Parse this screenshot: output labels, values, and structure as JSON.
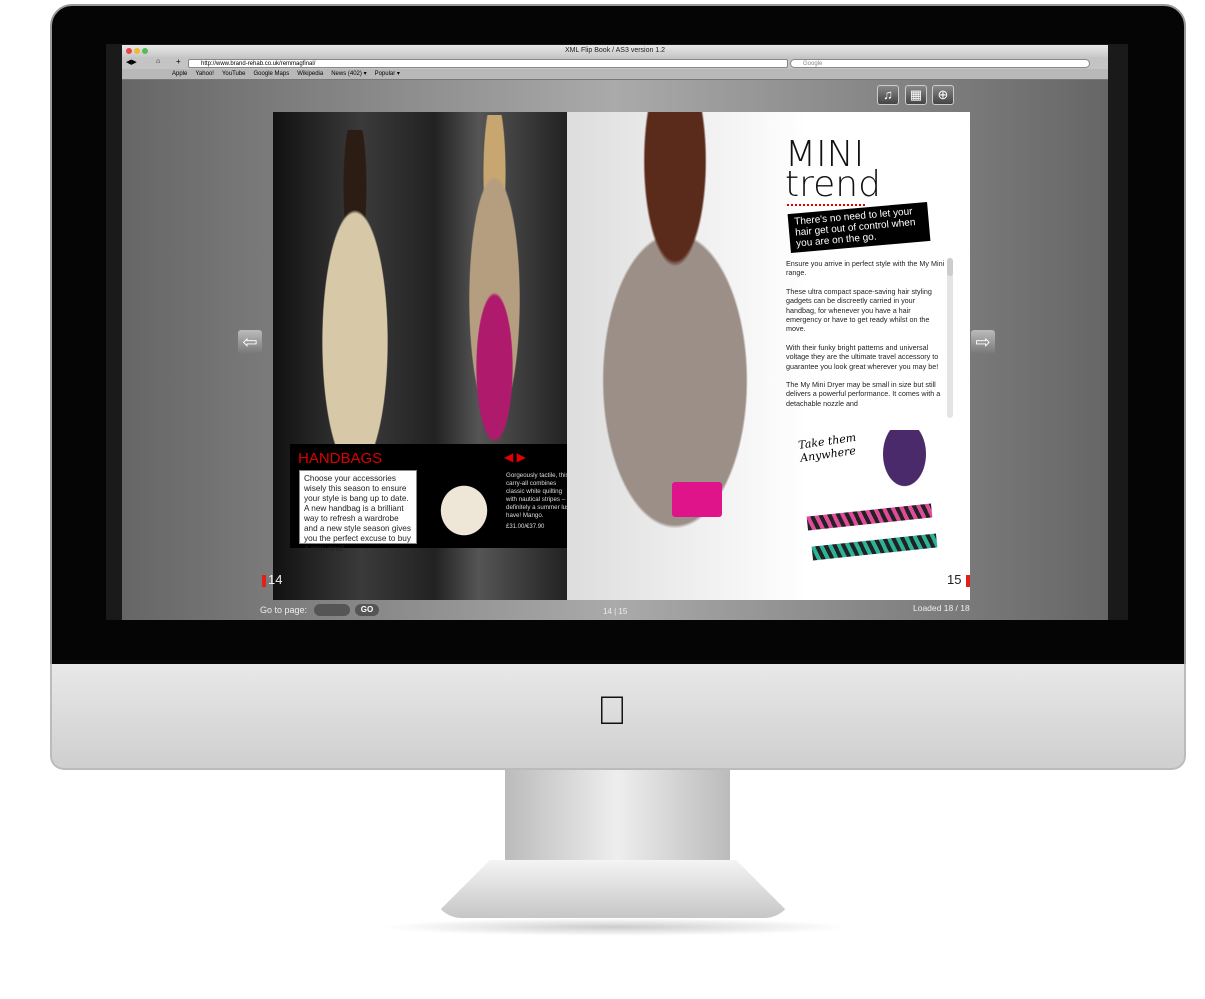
{
  "browser": {
    "title": "XML Flip Book / AS3 version 1.2",
    "url": "http://www.brand-rehab.co.uk/remmagfinal/",
    "search_placeholder": "Google",
    "bookmarks": [
      "Apple",
      "Yahoo!",
      "YouTube",
      "Google Maps",
      "Wikipedia",
      "News (402) ▾",
      "Popular ▾"
    ]
  },
  "toolbar": {
    "music": "♫",
    "film": "▦",
    "zoom": "⊕"
  },
  "nav": {
    "prev": "⇦",
    "next": "⇨"
  },
  "left_page": {
    "number": "14",
    "handbags": {
      "title": "HANDBAGS",
      "text": "Choose your accessories wisely this season to ensure your style is bang up to date. A new handbag is a brilliant way to refresh a wardrobe and a new style season gives you the perfect excuse to buy a new one!",
      "arrows": "◀ ▶",
      "description": "Gorgeously tactile, this carry-all combines classic white quilting with nautical stripes – definitely a summer lust-have! Mango.",
      "price": "£31.00/€37.90"
    }
  },
  "right_page": {
    "number": "15",
    "title_line1": "MINI",
    "title_line2": "trend",
    "tagline": "There's no need to let your hair get out of control when you are on the go.",
    "paragraphs": [
      "Ensure you arrive in perfect style with the My Mini range.",
      "These ultra compact space-saving hair styling gadgets can be discreetly carried in your handbag, for whenever you have a hair emergency or have to get ready whilst on the move.",
      "With their funky bright patterns and universal voltage they are the ultimate travel accessory to guarantee you look great wherever you may be!",
      "The My Mini Dryer may be small in size but still delivers a powerful performance. It comes with a detachable nozzle and"
    ],
    "handwriting": "Take them Anywhere"
  },
  "footer": {
    "goto_label": "Go to page:",
    "go_button": "GO",
    "pages": "14 | 15",
    "loaded": "Loaded 18 / 18"
  },
  "colors": {
    "accent": "#dd0000",
    "magenta": "#e0148a"
  }
}
